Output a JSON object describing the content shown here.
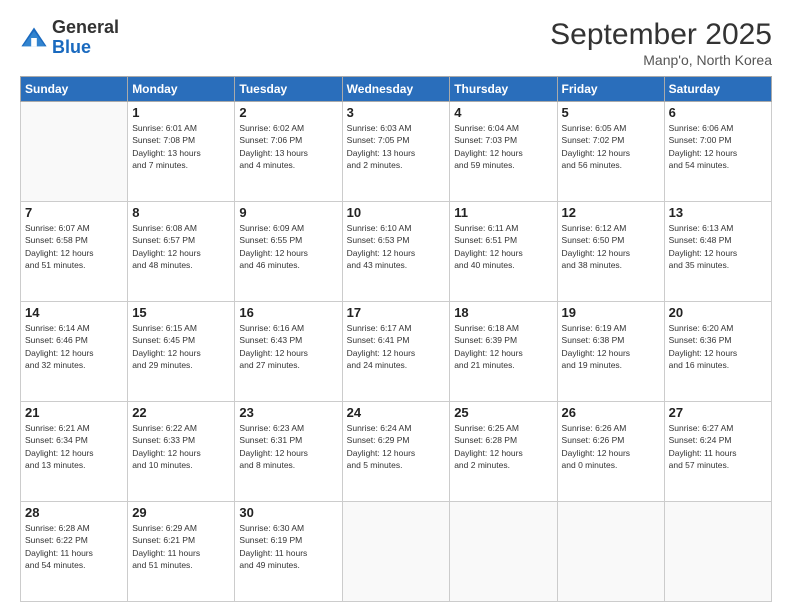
{
  "header": {
    "logo": {
      "general": "General",
      "blue": "Blue"
    },
    "title": "September 2025",
    "subtitle": "Manp'o, North Korea"
  },
  "days_of_week": [
    "Sunday",
    "Monday",
    "Tuesday",
    "Wednesday",
    "Thursday",
    "Friday",
    "Saturday"
  ],
  "weeks": [
    [
      {
        "day": "",
        "content": ""
      },
      {
        "day": "1",
        "content": "Sunrise: 6:01 AM\nSunset: 7:08 PM\nDaylight: 13 hours\nand 7 minutes."
      },
      {
        "day": "2",
        "content": "Sunrise: 6:02 AM\nSunset: 7:06 PM\nDaylight: 13 hours\nand 4 minutes."
      },
      {
        "day": "3",
        "content": "Sunrise: 6:03 AM\nSunset: 7:05 PM\nDaylight: 13 hours\nand 2 minutes."
      },
      {
        "day": "4",
        "content": "Sunrise: 6:04 AM\nSunset: 7:03 PM\nDaylight: 12 hours\nand 59 minutes."
      },
      {
        "day": "5",
        "content": "Sunrise: 6:05 AM\nSunset: 7:02 PM\nDaylight: 12 hours\nand 56 minutes."
      },
      {
        "day": "6",
        "content": "Sunrise: 6:06 AM\nSunset: 7:00 PM\nDaylight: 12 hours\nand 54 minutes."
      }
    ],
    [
      {
        "day": "7",
        "content": "Sunrise: 6:07 AM\nSunset: 6:58 PM\nDaylight: 12 hours\nand 51 minutes."
      },
      {
        "day": "8",
        "content": "Sunrise: 6:08 AM\nSunset: 6:57 PM\nDaylight: 12 hours\nand 48 minutes."
      },
      {
        "day": "9",
        "content": "Sunrise: 6:09 AM\nSunset: 6:55 PM\nDaylight: 12 hours\nand 46 minutes."
      },
      {
        "day": "10",
        "content": "Sunrise: 6:10 AM\nSunset: 6:53 PM\nDaylight: 12 hours\nand 43 minutes."
      },
      {
        "day": "11",
        "content": "Sunrise: 6:11 AM\nSunset: 6:51 PM\nDaylight: 12 hours\nand 40 minutes."
      },
      {
        "day": "12",
        "content": "Sunrise: 6:12 AM\nSunset: 6:50 PM\nDaylight: 12 hours\nand 38 minutes."
      },
      {
        "day": "13",
        "content": "Sunrise: 6:13 AM\nSunset: 6:48 PM\nDaylight: 12 hours\nand 35 minutes."
      }
    ],
    [
      {
        "day": "14",
        "content": "Sunrise: 6:14 AM\nSunset: 6:46 PM\nDaylight: 12 hours\nand 32 minutes."
      },
      {
        "day": "15",
        "content": "Sunrise: 6:15 AM\nSunset: 6:45 PM\nDaylight: 12 hours\nand 29 minutes."
      },
      {
        "day": "16",
        "content": "Sunrise: 6:16 AM\nSunset: 6:43 PM\nDaylight: 12 hours\nand 27 minutes."
      },
      {
        "day": "17",
        "content": "Sunrise: 6:17 AM\nSunset: 6:41 PM\nDaylight: 12 hours\nand 24 minutes."
      },
      {
        "day": "18",
        "content": "Sunrise: 6:18 AM\nSunset: 6:39 PM\nDaylight: 12 hours\nand 21 minutes."
      },
      {
        "day": "19",
        "content": "Sunrise: 6:19 AM\nSunset: 6:38 PM\nDaylight: 12 hours\nand 19 minutes."
      },
      {
        "day": "20",
        "content": "Sunrise: 6:20 AM\nSunset: 6:36 PM\nDaylight: 12 hours\nand 16 minutes."
      }
    ],
    [
      {
        "day": "21",
        "content": "Sunrise: 6:21 AM\nSunset: 6:34 PM\nDaylight: 12 hours\nand 13 minutes."
      },
      {
        "day": "22",
        "content": "Sunrise: 6:22 AM\nSunset: 6:33 PM\nDaylight: 12 hours\nand 10 minutes."
      },
      {
        "day": "23",
        "content": "Sunrise: 6:23 AM\nSunset: 6:31 PM\nDaylight: 12 hours\nand 8 minutes."
      },
      {
        "day": "24",
        "content": "Sunrise: 6:24 AM\nSunset: 6:29 PM\nDaylight: 12 hours\nand 5 minutes."
      },
      {
        "day": "25",
        "content": "Sunrise: 6:25 AM\nSunset: 6:28 PM\nDaylight: 12 hours\nand 2 minutes."
      },
      {
        "day": "26",
        "content": "Sunrise: 6:26 AM\nSunset: 6:26 PM\nDaylight: 12 hours\nand 0 minutes."
      },
      {
        "day": "27",
        "content": "Sunrise: 6:27 AM\nSunset: 6:24 PM\nDaylight: 11 hours\nand 57 minutes."
      }
    ],
    [
      {
        "day": "28",
        "content": "Sunrise: 6:28 AM\nSunset: 6:22 PM\nDaylight: 11 hours\nand 54 minutes."
      },
      {
        "day": "29",
        "content": "Sunrise: 6:29 AM\nSunset: 6:21 PM\nDaylight: 11 hours\nand 51 minutes."
      },
      {
        "day": "30",
        "content": "Sunrise: 6:30 AM\nSunset: 6:19 PM\nDaylight: 11 hours\nand 49 minutes."
      },
      {
        "day": "",
        "content": ""
      },
      {
        "day": "",
        "content": ""
      },
      {
        "day": "",
        "content": ""
      },
      {
        "day": "",
        "content": ""
      }
    ]
  ]
}
